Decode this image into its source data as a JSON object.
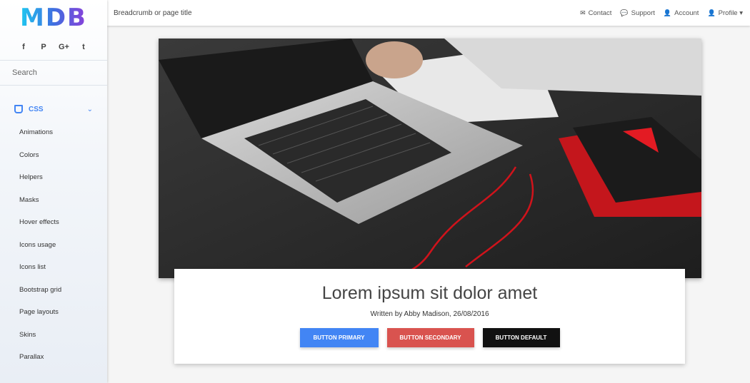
{
  "sidebar": {
    "logo_text": "MDB",
    "socials": [
      {
        "icon": "facebook-icon",
        "glyph": "f"
      },
      {
        "icon": "pinterest-icon",
        "glyph": "P"
      },
      {
        "icon": "google-plus-icon",
        "glyph": "G+"
      },
      {
        "icon": "twitter-icon",
        "glyph": "t"
      }
    ],
    "search_placeholder": "Search",
    "section": {
      "label": "CSS",
      "icon": "css3-icon",
      "chevron": "⌄"
    },
    "items": [
      {
        "label": "Animations"
      },
      {
        "label": "Colors"
      },
      {
        "label": "Helpers"
      },
      {
        "label": "Masks"
      },
      {
        "label": "Hover effects"
      },
      {
        "label": "Icons usage"
      },
      {
        "label": "Icons list"
      },
      {
        "label": "Bootstrap grid"
      },
      {
        "label": "Page layouts"
      },
      {
        "label": "Skins"
      },
      {
        "label": "Parallax"
      }
    ]
  },
  "topbar": {
    "breadcrumb": "Breadcrumb or page title",
    "nav": [
      {
        "label": "Contact",
        "icon": "envelope-icon",
        "glyph": "✉"
      },
      {
        "label": "Support",
        "icon": "comments-icon",
        "glyph": "💬"
      },
      {
        "label": "Account",
        "icon": "user-icon",
        "glyph": "👤"
      },
      {
        "label": "Profile ▾",
        "icon": "user-icon",
        "glyph": "👤"
      }
    ]
  },
  "card": {
    "title": "Lorem ipsum sit dolor amet",
    "byline": "Written by Abby Madison, 26/08/2016",
    "buttons": {
      "primary": "BUTTON PRIMARY",
      "secondary": "BUTTON SECONDARY",
      "default": "BUTTON DEFAULT"
    }
  },
  "colors": {
    "primary": "#4285f4",
    "secondary": "#d9534f",
    "default": "#111111"
  }
}
